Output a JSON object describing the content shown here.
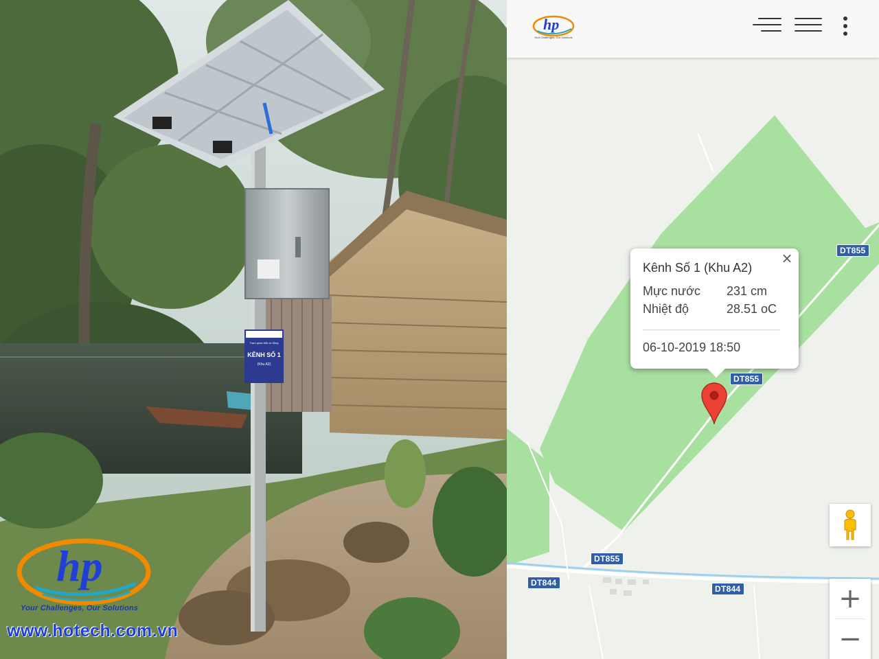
{
  "colors": {
    "map_background": "#eef1ec",
    "forest_green": "#a8e0a0",
    "road_label_blue": "#2e5fa8",
    "marker_red": "#ea4335",
    "brand_blue": "#1f3fd6",
    "brand_orange": "#f08a00"
  },
  "photo": {
    "watermark": {
      "logo_text": "hp",
      "tagline": "Your Challenges, Our Solutions",
      "url": "www.hotech.com.vn"
    },
    "sign": {
      "line1": "Trạm quan trắc tự động",
      "title": "KÊNH SỐ 1",
      "subtitle": "(Khu A2)"
    }
  },
  "app": {
    "header": {
      "logo_text": "hp",
      "logo_tagline": "Your Challenges, Our Solutions",
      "icons": [
        "menu-right-aligned-icon",
        "menu-icon",
        "more-vert-icon"
      ]
    },
    "map": {
      "road_labels": [
        "DT855",
        "DT855",
        "DT855",
        "DT844",
        "DT844"
      ],
      "marker_icon": "map-pin-icon",
      "pegman_icon": "street-view-pegman-icon",
      "zoom_in": "+",
      "zoom_out": "−"
    },
    "infowindow": {
      "title": "Kênh Số 1 (Khu A2)",
      "close": "×",
      "rows": [
        {
          "label": "Mực nước",
          "value": "231 cm"
        },
        {
          "label": "Nhiệt độ",
          "value": "28.51 oC"
        }
      ],
      "timestamp": "06-10-2019 18:50"
    }
  }
}
